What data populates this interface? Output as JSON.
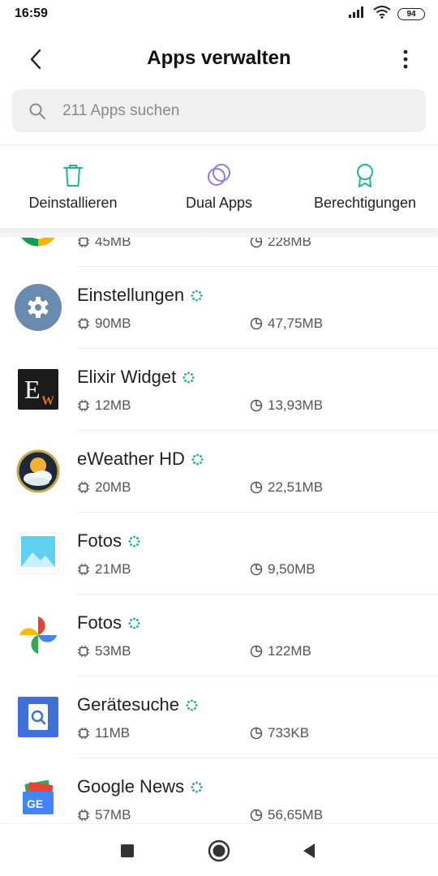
{
  "status_bar": {
    "time": "16:59",
    "battery": "94"
  },
  "header": {
    "title": "Apps verwalten"
  },
  "search": {
    "placeholder": "211 Apps suchen"
  },
  "actions": [
    {
      "label": "Deinstallieren",
      "icon": "trash-icon",
      "color": "#1db896"
    },
    {
      "label": "Dual Apps",
      "icon": "dual-circles-icon",
      "color": "#8a7fe0"
    },
    {
      "label": "Berechtigungen",
      "icon": "ribbon-badge-icon",
      "color": "#1db896"
    }
  ],
  "apps": [
    {
      "name": "",
      "app_size": "45MB",
      "total_size": "228MB",
      "icon": "partial-app-icon"
    },
    {
      "name": "Einstellungen",
      "app_size": "90MB",
      "total_size": "47,75MB",
      "icon": "settings-gear-icon"
    },
    {
      "name": "Elixir Widget",
      "app_size": "12MB",
      "total_size": "13,93MB",
      "icon": "elixir-widget-icon"
    },
    {
      "name": "eWeather HD",
      "app_size": "20MB",
      "total_size": "22,51MB",
      "icon": "eweather-icon"
    },
    {
      "name": "Fotos",
      "app_size": "21MB",
      "total_size": "9,50MB",
      "icon": "gallery-icon"
    },
    {
      "name": "Fotos",
      "app_size": "53MB",
      "total_size": "122MB",
      "icon": "google-photos-pinwheel-icon"
    },
    {
      "name": "Gerätesuche",
      "app_size": "11MB",
      "total_size": "733KB",
      "icon": "device-finder-icon"
    },
    {
      "name": "Google News",
      "app_size": "57MB",
      "total_size": "56,65MB",
      "icon": "google-news-icon"
    }
  ],
  "colors": {
    "accent": "#1db896",
    "spinner": "#22b573"
  }
}
